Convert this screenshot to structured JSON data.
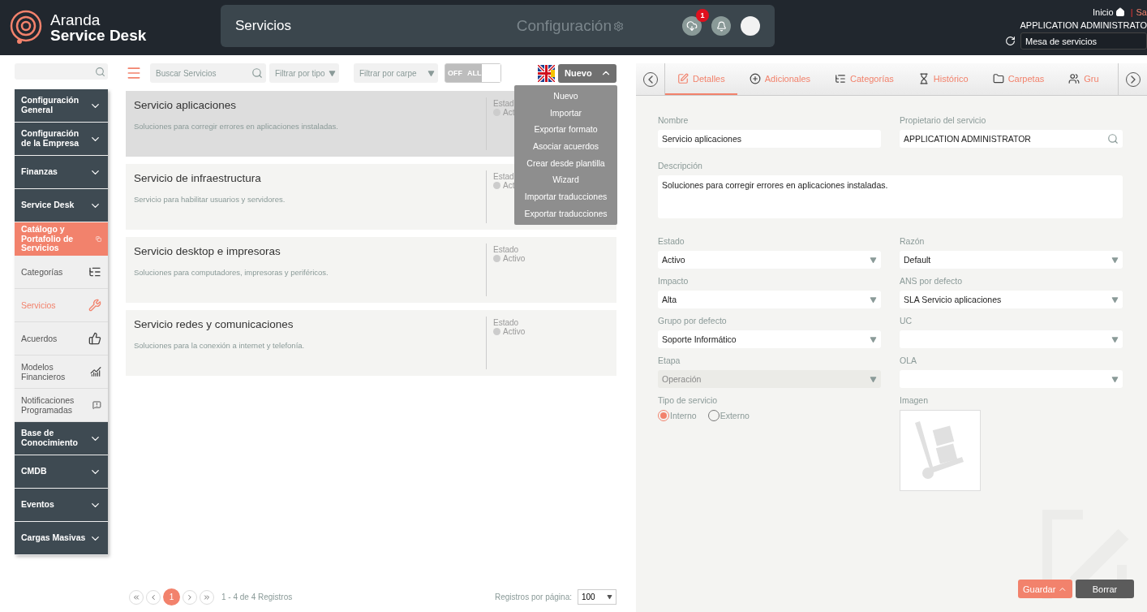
{
  "header": {
    "brand_top": "Aranda",
    "brand_bottom": "Service Desk",
    "title": "Servicios",
    "config_label": "Configuración",
    "download_badge": "1",
    "home_label": "Inicio",
    "separator": "|",
    "logout_label": "Sa",
    "user": "APPLICATION ADMINISTRATO",
    "desk_select": "Mesa de servicios"
  },
  "sidebar": {
    "groups": [
      {
        "label": "Configuración General"
      },
      {
        "label": "Configuración de la Empresa"
      },
      {
        "label": "Finanzas"
      },
      {
        "label": "Service Desk",
        "children": [
          {
            "label": "Catálogo y Portafolio de Servicios",
            "children": [
              {
                "label": "Categorías",
                "selected": false
              },
              {
                "label": "Servicios",
                "selected": true
              },
              {
                "label": "Acuerdos",
                "selected": false
              },
              {
                "label": "Modelos Financieros",
                "selected": false
              },
              {
                "label": "Notificaciones Programadas",
                "selected": false
              }
            ]
          }
        ]
      },
      {
        "label": "Base de Conocimiento"
      },
      {
        "label": "CMDB"
      },
      {
        "label": "Eventos"
      },
      {
        "label": "Cargas Masivas"
      }
    ]
  },
  "toolbar": {
    "search": {
      "placeholder": "Buscar Servicios"
    },
    "type_filter": "Filtrar por tipo",
    "folder_filter": "Filtrar por carpe",
    "toggle": {
      "off_label": "OFF",
      "on_label": "ALL",
      "on": false
    },
    "new_button": "Nuevo",
    "menu_open": true,
    "menu": [
      "Nuevo",
      "Importar",
      "Exportar formato",
      "Asociar acuerdos",
      "Crear desde plantilla",
      "Wizard",
      "Importar traducciones",
      "Exportar traducciones"
    ]
  },
  "services": [
    {
      "name": "Servicio aplicaciones",
      "description": "Soluciones para corregir errores en aplicaciones instaladas.",
      "status_label": "Estad",
      "status": "Act",
      "selected": true
    },
    {
      "name": "Servicio de infraestructura",
      "description": "Servicio para habilitar usuarios y servidores.",
      "status_label": "Estad",
      "status": "Act",
      "selected": false
    },
    {
      "name": "Servicio desktop e impresoras",
      "description": "Soluciones para computadores, impresoras y periféricos.",
      "status_label": "Estado",
      "status": "Activo",
      "selected": false
    },
    {
      "name": "Servicio redes y comunicaciones",
      "description": "Soluciones para la conexión a internet y telefonía.",
      "status_label": "Estado",
      "status": "Activo",
      "selected": false
    }
  ],
  "pagination": {
    "pages": [
      {
        "label": "1",
        "selected": true
      }
    ],
    "summary": "1 - 4 de 4 Registros",
    "per_page_label": "Registros por página:",
    "per_page": "100"
  },
  "detail": {
    "tabs": [
      {
        "label": "Detalles",
        "selected": true
      },
      {
        "label": "Adicionales",
        "selected": false
      },
      {
        "label": "Categorías",
        "selected": false
      },
      {
        "label": "Histórico",
        "selected": false
      },
      {
        "label": "Carpetas",
        "selected": false
      },
      {
        "label": "Gru",
        "selected": false
      }
    ],
    "fields": [
      {
        "kind": "text",
        "label": "Nombre",
        "value": "Servicio aplicaciones"
      },
      {
        "kind": "search",
        "label": "Propietario del servicio",
        "value": "APPLICATION ADMINISTRATOR"
      },
      {
        "kind": "textarea",
        "label": "Descripción",
        "value": "Soluciones para corregir errores en aplicaciones instaladas."
      },
      {
        "kind": "select",
        "label": "Estado",
        "value": "Activo",
        "disabled": false
      },
      {
        "kind": "select",
        "label": "Razón",
        "value": "Default",
        "disabled": false
      },
      {
        "kind": "select",
        "label": "Impacto",
        "value": "Alta",
        "disabled": false
      },
      {
        "kind": "select",
        "label": "ANS por defecto",
        "value": "SLA Servicio aplicaciones",
        "disabled": false
      },
      {
        "kind": "select",
        "label": "Grupo por defecto",
        "value": "Soporte Informático",
        "disabled": false
      },
      {
        "kind": "select",
        "label": "UC",
        "disabled": false
      },
      {
        "kind": "select",
        "label": "Etapa",
        "value": "Operación",
        "disabled": true
      },
      {
        "kind": "select",
        "label": "OLA",
        "disabled": false
      },
      {
        "kind": "radio",
        "label": "Tipo de servicio",
        "options": [
          {
            "label": "Interno",
            "selected": true
          },
          {
            "label": "Externo",
            "selected": false
          }
        ]
      },
      {
        "kind": "image",
        "label": "Imagen"
      }
    ],
    "buttons": [
      {
        "kind": "primary",
        "label": "Guardar"
      },
      {
        "kind": "secondary",
        "label": "Borrar"
      }
    ]
  }
}
